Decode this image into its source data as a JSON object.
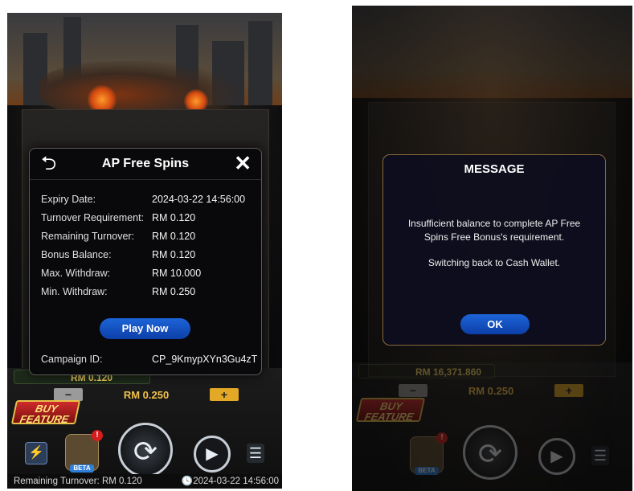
{
  "left_screen": {
    "bottom": {
      "win_amount": "RM 0.120",
      "bet_value": "RM 0.250",
      "minus_label": "−",
      "plus_label": "+",
      "buy_feature_line1": "BUY",
      "buy_feature_line2": "FEATURE",
      "beta_label": "BETA",
      "badge_count": "!"
    },
    "status": {
      "remaining_turnover": "Remaining Turnover: RM 0.120",
      "datetime": "2024-03-22 14:56:00"
    },
    "modal": {
      "title": "AP Free Spins",
      "rows": [
        {
          "label": "Expiry Date:",
          "value": "2024-03-22 14:56:00"
        },
        {
          "label": "Turnover Requirement:",
          "value": "RM 0.120"
        },
        {
          "label": "Remaining Turnover:",
          "value": "RM 0.120"
        },
        {
          "label": "Bonus Balance:",
          "value": "RM 0.120"
        },
        {
          "label": "Max. Withdraw:",
          "value": "RM 10.000"
        },
        {
          "label": "Min. Withdraw:",
          "value": "RM 0.250"
        }
      ],
      "play_label": "Play Now",
      "campaign_label": "Campaign ID:",
      "campaign_value": "CP_9KmypXYn3Gu4zT"
    }
  },
  "right_screen": {
    "bottom": {
      "balance": "RM 16,371.860",
      "bet_value": "RM 0.250",
      "minus_label": "−",
      "plus_label": "+",
      "buy_feature_line1": "BUY",
      "buy_feature_line2": "FEATURE",
      "beta_label": "BETA",
      "badge_count": "!"
    },
    "message": {
      "title": "MESSAGE",
      "body": "Insufficient balance to complete AP Free Spins Free Bonus's requirement.",
      "body2": "Switching back to Cash Wallet.",
      "ok_label": "OK"
    }
  },
  "icons": {
    "back": "return-arrow-icon",
    "close": "close-icon",
    "spin": "spin-icon",
    "autoplay": "autoplay-icon",
    "menu": "menu-icon",
    "turbo": "lightning-icon",
    "clock": "clock-icon"
  },
  "colors": {
    "accent_blue": "#1d64d8",
    "gold": "#f2c24a",
    "modal_border_right": "#8a6a3a"
  }
}
